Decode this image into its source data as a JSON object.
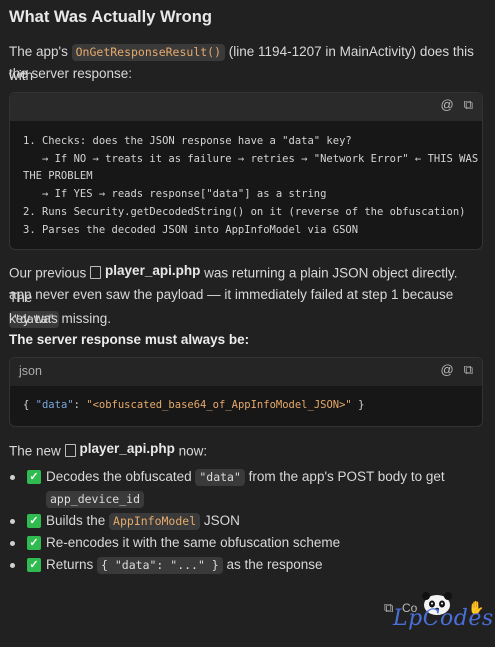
{
  "heading": "What Was Actually Wrong",
  "para1": {
    "pre": "The app's ",
    "code": "OnGetResponseResult()",
    "post": " (line 1194-1207 in MainActivity) does this with",
    "line2": "the server response:"
  },
  "code1": {
    "copy_icon": "copy-icon",
    "at_icon": "at-icon",
    "lines": [
      "1. Checks: does the JSON response have a \"data\" key?",
      "   → If NO → treats it as failure → retries → \"Network Error\" ← THIS WAS",
      "THE PROBLEM",
      "   → If YES → reads response[\"data\"] as a string",
      "2. Runs Security.getDecodedString() on it (reverse of the obfuscation)",
      "3. Parses the decoded JSON into AppInfoModel via GSON"
    ]
  },
  "para2": {
    "pre": "Our previous ",
    "file": "player_api.php",
    "post": " was returning a plain JSON object directly. The",
    "line2": "app never even saw the payload — it immediately failed at step 1 because",
    "code": "\"data\"",
    "line3": "key was missing."
  },
  "bold_line": "The server response must always be:",
  "code2": {
    "lang": "json",
    "brace_open": "{ ",
    "key": "\"data\"",
    "colon": ": ",
    "value": "\"<obfuscated_base64_of_AppInfoModel_JSON>\"",
    "brace_close": " }"
  },
  "para3": {
    "pre": "The new ",
    "file": "player_api.php",
    "post": " now:"
  },
  "list": [
    {
      "pre": "Decodes the obfuscated ",
      "code": "\"data\"",
      "post": " from the app's POST body to get",
      "code2": "app_device_id"
    },
    {
      "pre": "Builds the ",
      "code": "AppInfoModel",
      "post": " JSON"
    },
    {
      "pre": "Re-encodes it with the same obfuscation scheme"
    },
    {
      "pre": "Returns ",
      "code": "{ \"data\": \"...\" }",
      "post": " as the response"
    }
  ],
  "footer": {
    "copy_label": "Co",
    "watermark": "LpCodes"
  },
  "colors": {
    "accent_code": "#e6a96b",
    "check": "#2fbb4f",
    "watermark": "#4a6fd6",
    "bg": "#212121"
  }
}
